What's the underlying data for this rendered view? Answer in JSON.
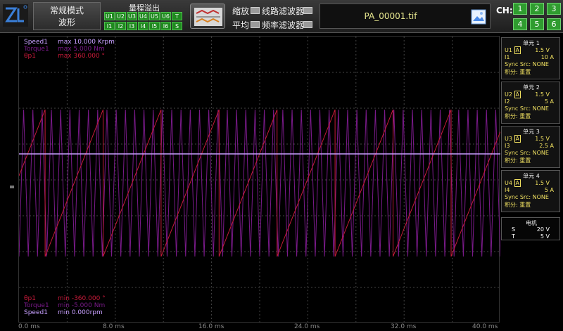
{
  "header": {
    "mode_line1": "常规模式",
    "mode_line2": "波形",
    "overflow_title": "量程溢出",
    "overflow_row1": [
      "U1",
      "U2",
      "U3",
      "U4",
      "U5",
      "U6",
      "T"
    ],
    "overflow_row2": [
      "I1",
      "I2",
      "I3",
      "I4",
      "I5",
      "I6",
      "S"
    ],
    "zoom_label": "缩放",
    "line_filter_label": "线路滤波器",
    "avg_label": "平均",
    "freq_filter_label": "频率滤波器",
    "file_name": "PA_00001.tif",
    "ch_label": "CH:",
    "channels": [
      "1",
      "2",
      "3",
      "4",
      "5",
      "6"
    ]
  },
  "legend_top": [
    {
      "name": "Speed1",
      "text": "max 10.000 Krpm",
      "color": "#c8a0ff"
    },
    {
      "name": "Torque1",
      "text": "max 5.000 Nm",
      "color": "#7a1a8a"
    },
    {
      "name": "θp1",
      "text": "max 360.000 °",
      "color": "#c81a3a"
    }
  ],
  "legend_bottom": [
    {
      "name": "θp1",
      "text": "min -360.000 °",
      "color": "#c81a3a"
    },
    {
      "name": "Torque1",
      "text": "min -5.000 Nm",
      "color": "#7a1a8a"
    },
    {
      "name": "Speed1",
      "text": "min 0.000rpm",
      "color": "#c8a0ff"
    }
  ],
  "x_ticks": [
    "0.0 ms",
    "8.0 ms",
    "16.0 ms",
    "24.0 ms",
    "32.0 ms",
    "40.0 ms"
  ],
  "units": [
    {
      "title": "单元 1",
      "u": "U1",
      "u_val": "1.5 V",
      "i": "I1",
      "i_val": "10 A",
      "sync": "Sync Src: NONE",
      "integ": "积分: 重置"
    },
    {
      "title": "单元 2",
      "u": "U2",
      "u_val": "1.5 V",
      "i": "I2",
      "i_val": "5 A",
      "sync": "Sync Src: NONE",
      "integ": "积分: 重置"
    },
    {
      "title": "单元 3",
      "u": "U3",
      "u_val": "1.5 V",
      "i": "I3",
      "i_val": "2.5 A",
      "sync": "Sync Src: NONE",
      "integ": "积分: 重置"
    },
    {
      "title": "单元 4",
      "u": "U4",
      "u_val": "1.5 V",
      "i": "I4",
      "i_val": "5 A",
      "sync": "Sync Src: NONE",
      "integ": "积分: 重置"
    }
  ],
  "motor": {
    "title": "电机",
    "s_label": "S",
    "s_val": "20 V",
    "t_label": "T",
    "t_val": "5 V"
  },
  "colors": {
    "speed": "#c8a0ff",
    "torque": "#7a1a8a",
    "angle": "#c81a3a",
    "indicator": "#1f8a1f",
    "unit_text": "#f0e060"
  }
}
